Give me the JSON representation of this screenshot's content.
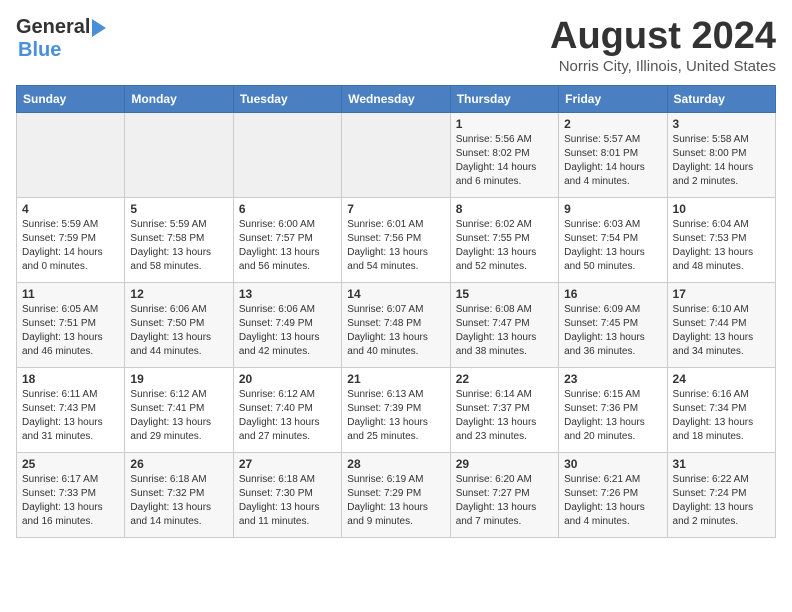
{
  "header": {
    "logo_general": "General",
    "logo_blue": "Blue",
    "month_title": "August 2024",
    "location": "Norris City, Illinois, United States"
  },
  "weekdays": [
    "Sunday",
    "Monday",
    "Tuesday",
    "Wednesday",
    "Thursday",
    "Friday",
    "Saturday"
  ],
  "weeks": [
    [
      {
        "day": "",
        "info": ""
      },
      {
        "day": "",
        "info": ""
      },
      {
        "day": "",
        "info": ""
      },
      {
        "day": "",
        "info": ""
      },
      {
        "day": "1",
        "info": "Sunrise: 5:56 AM\nSunset: 8:02 PM\nDaylight: 14 hours\nand 6 minutes."
      },
      {
        "day": "2",
        "info": "Sunrise: 5:57 AM\nSunset: 8:01 PM\nDaylight: 14 hours\nand 4 minutes."
      },
      {
        "day": "3",
        "info": "Sunrise: 5:58 AM\nSunset: 8:00 PM\nDaylight: 14 hours\nand 2 minutes."
      }
    ],
    [
      {
        "day": "4",
        "info": "Sunrise: 5:59 AM\nSunset: 7:59 PM\nDaylight: 14 hours\nand 0 minutes."
      },
      {
        "day": "5",
        "info": "Sunrise: 5:59 AM\nSunset: 7:58 PM\nDaylight: 13 hours\nand 58 minutes."
      },
      {
        "day": "6",
        "info": "Sunrise: 6:00 AM\nSunset: 7:57 PM\nDaylight: 13 hours\nand 56 minutes."
      },
      {
        "day": "7",
        "info": "Sunrise: 6:01 AM\nSunset: 7:56 PM\nDaylight: 13 hours\nand 54 minutes."
      },
      {
        "day": "8",
        "info": "Sunrise: 6:02 AM\nSunset: 7:55 PM\nDaylight: 13 hours\nand 52 minutes."
      },
      {
        "day": "9",
        "info": "Sunrise: 6:03 AM\nSunset: 7:54 PM\nDaylight: 13 hours\nand 50 minutes."
      },
      {
        "day": "10",
        "info": "Sunrise: 6:04 AM\nSunset: 7:53 PM\nDaylight: 13 hours\nand 48 minutes."
      }
    ],
    [
      {
        "day": "11",
        "info": "Sunrise: 6:05 AM\nSunset: 7:51 PM\nDaylight: 13 hours\nand 46 minutes."
      },
      {
        "day": "12",
        "info": "Sunrise: 6:06 AM\nSunset: 7:50 PM\nDaylight: 13 hours\nand 44 minutes."
      },
      {
        "day": "13",
        "info": "Sunrise: 6:06 AM\nSunset: 7:49 PM\nDaylight: 13 hours\nand 42 minutes."
      },
      {
        "day": "14",
        "info": "Sunrise: 6:07 AM\nSunset: 7:48 PM\nDaylight: 13 hours\nand 40 minutes."
      },
      {
        "day": "15",
        "info": "Sunrise: 6:08 AM\nSunset: 7:47 PM\nDaylight: 13 hours\nand 38 minutes."
      },
      {
        "day": "16",
        "info": "Sunrise: 6:09 AM\nSunset: 7:45 PM\nDaylight: 13 hours\nand 36 minutes."
      },
      {
        "day": "17",
        "info": "Sunrise: 6:10 AM\nSunset: 7:44 PM\nDaylight: 13 hours\nand 34 minutes."
      }
    ],
    [
      {
        "day": "18",
        "info": "Sunrise: 6:11 AM\nSunset: 7:43 PM\nDaylight: 13 hours\nand 31 minutes."
      },
      {
        "day": "19",
        "info": "Sunrise: 6:12 AM\nSunset: 7:41 PM\nDaylight: 13 hours\nand 29 minutes."
      },
      {
        "day": "20",
        "info": "Sunrise: 6:12 AM\nSunset: 7:40 PM\nDaylight: 13 hours\nand 27 minutes."
      },
      {
        "day": "21",
        "info": "Sunrise: 6:13 AM\nSunset: 7:39 PM\nDaylight: 13 hours\nand 25 minutes."
      },
      {
        "day": "22",
        "info": "Sunrise: 6:14 AM\nSunset: 7:37 PM\nDaylight: 13 hours\nand 23 minutes."
      },
      {
        "day": "23",
        "info": "Sunrise: 6:15 AM\nSunset: 7:36 PM\nDaylight: 13 hours\nand 20 minutes."
      },
      {
        "day": "24",
        "info": "Sunrise: 6:16 AM\nSunset: 7:34 PM\nDaylight: 13 hours\nand 18 minutes."
      }
    ],
    [
      {
        "day": "25",
        "info": "Sunrise: 6:17 AM\nSunset: 7:33 PM\nDaylight: 13 hours\nand 16 minutes."
      },
      {
        "day": "26",
        "info": "Sunrise: 6:18 AM\nSunset: 7:32 PM\nDaylight: 13 hours\nand 14 minutes."
      },
      {
        "day": "27",
        "info": "Sunrise: 6:18 AM\nSunset: 7:30 PM\nDaylight: 13 hours\nand 11 minutes."
      },
      {
        "day": "28",
        "info": "Sunrise: 6:19 AM\nSunset: 7:29 PM\nDaylight: 13 hours\nand 9 minutes."
      },
      {
        "day": "29",
        "info": "Sunrise: 6:20 AM\nSunset: 7:27 PM\nDaylight: 13 hours\nand 7 minutes."
      },
      {
        "day": "30",
        "info": "Sunrise: 6:21 AM\nSunset: 7:26 PM\nDaylight: 13 hours\nand 4 minutes."
      },
      {
        "day": "31",
        "info": "Sunrise: 6:22 AM\nSunset: 7:24 PM\nDaylight: 13 hours\nand 2 minutes."
      }
    ]
  ]
}
